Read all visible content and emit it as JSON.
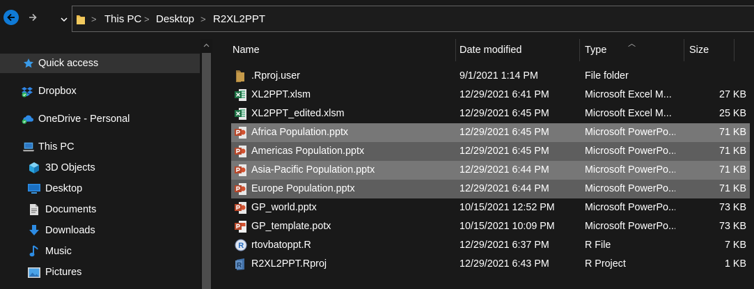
{
  "address_bar": {
    "breadcrumbs": [
      "This PC",
      "Desktop",
      "R2XL2PPT"
    ],
    "separator": ">"
  },
  "nav_pane": {
    "items": [
      {
        "label": "Quick access",
        "icon": "star-icon"
      },
      {
        "label": "Dropbox",
        "icon": "dropbox-icon"
      },
      {
        "label": "OneDrive - Personal",
        "icon": "onedrive-cloud-icon"
      },
      {
        "label": "This PC",
        "icon": "computer-icon"
      },
      {
        "label": "3D Objects",
        "icon": "cube-icon"
      },
      {
        "label": "Desktop",
        "icon": "desktop-icon"
      },
      {
        "label": "Documents",
        "icon": "document-icon"
      },
      {
        "label": "Downloads",
        "icon": "download-arrow-icon"
      },
      {
        "label": "Music",
        "icon": "music-note-icon"
      },
      {
        "label": "Pictures",
        "icon": "picture-icon"
      }
    ]
  },
  "file_list": {
    "columns": [
      "Name",
      "Date modified",
      "Type",
      "Size"
    ],
    "rows": [
      {
        "name": ".Rproj.user",
        "date": "9/1/2021 1:14 PM",
        "type": "File folder",
        "size": "",
        "icon": "folder-icon"
      },
      {
        "name": "XL2PPT.xlsm",
        "date": "12/29/2021 6:41 PM",
        "type": "Microsoft Excel M...",
        "size": "27 KB",
        "icon": "excel-file-icon"
      },
      {
        "name": "XL2PPT_edited.xlsm",
        "date": "12/29/2021 6:45 PM",
        "type": "Microsoft Excel M...",
        "size": "25 KB",
        "icon": "excel-file-icon"
      },
      {
        "name": "Africa Population.pptx",
        "date": "12/29/2021 6:45 PM",
        "type": "Microsoft PowerPo...",
        "size": "71 KB",
        "icon": "powerpoint-file-icon"
      },
      {
        "name": "Americas Population.pptx",
        "date": "12/29/2021 6:45 PM",
        "type": "Microsoft PowerPo...",
        "size": "71 KB",
        "icon": "powerpoint-file-icon"
      },
      {
        "name": "Asia-Pacific Population.pptx",
        "date": "12/29/2021 6:44 PM",
        "type": "Microsoft PowerPo...",
        "size": "71 KB",
        "icon": "powerpoint-file-icon"
      },
      {
        "name": "Europe Population.pptx",
        "date": "12/29/2021 6:44 PM",
        "type": "Microsoft PowerPo...",
        "size": "71 KB",
        "icon": "powerpoint-file-icon"
      },
      {
        "name": "GP_world.pptx",
        "date": "10/15/2021 12:52 PM",
        "type": "Microsoft PowerPo...",
        "size": "73 KB",
        "icon": "powerpoint-file-icon"
      },
      {
        "name": "GP_template.potx",
        "date": "10/15/2021 10:09 PM",
        "type": "Microsoft PowerPo...",
        "size": "73 KB",
        "icon": "powerpoint-template-icon"
      },
      {
        "name": "rtovbatoppt.R",
        "date": "12/29/2021 6:37 PM",
        "type": "R File",
        "size": "7 KB",
        "icon": "r-file-icon"
      },
      {
        "name": "R2XL2PPT.Rproj",
        "date": "12/29/2021 6:43 PM",
        "type": "R Project",
        "size": "1 KB",
        "icon": "r-project-icon"
      }
    ]
  },
  "colors": {
    "background": "#191919",
    "selection": "#777777",
    "accent": "#0f7ad6"
  }
}
